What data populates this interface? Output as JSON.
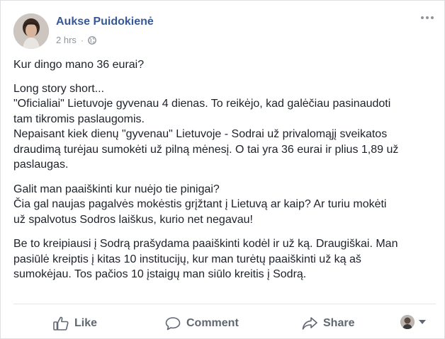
{
  "post": {
    "author": "Aukse Puidokienė",
    "timestamp": "2 hrs",
    "separator": "·",
    "privacy_icon": "globe-icon",
    "menu_icon": "more-options-icon"
  },
  "content": {
    "p1": [
      "Kur dingo mano 36 eurai?"
    ],
    "p2": [
      "Long story short...",
      "\"Oficialiai\" Lietuvoje gyvenau 4 dienas. To reikėjo, kad galėčiau pasinaudoti",
      "tam tikromis paslaugomis.",
      "Nepaisant kiek dienų \"gyvenau\" Lietuvoje - Sodrai už privalomąjį sveikatos",
      "draudimą turėjau sumokėti už pilną mėnesį. O tai yra 36 eurai ir plius 1,89 už",
      "paslaugas."
    ],
    "p3": [
      "Galit man paaiškinti kur nuėjo tie pinigai?",
      "Čia gal naujas pagalvės mokėstis grįžtant į Lietuvą ar kaip? Ar turiu mokėti",
      "už spalvotus Sodros laiškus, kurio net negavau!"
    ],
    "p4": [
      "Be to kreipiausi į Sodrą prašydama paaiškinti kodėl ir už ką. Draugiškai. Man",
      "pasiūlė kreiptis į kitas 10 institucijų, kur man turėtų paaiškinti už ką aš",
      "sumokėjau. Tos pačios 10 įstaigų man siūlo kreitis į Sodrą."
    ]
  },
  "actions": {
    "like": "Like",
    "comment": "Comment",
    "share": "Share"
  },
  "colors": {
    "author": "#365899",
    "meta": "#90949c",
    "action": "#606770"
  }
}
